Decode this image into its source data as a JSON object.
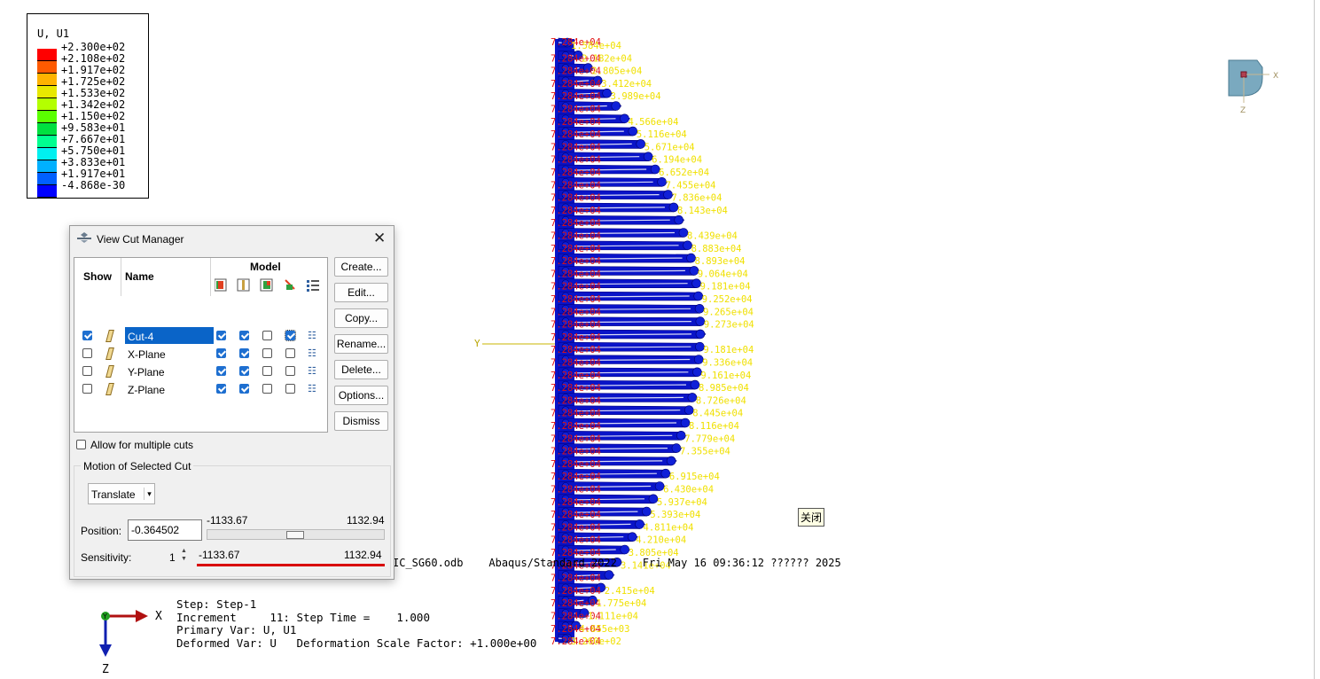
{
  "legend": {
    "title": "U, U1",
    "values": [
      "+2.300e+02",
      "+2.108e+02",
      "+1.917e+02",
      "+1.725e+02",
      "+1.533e+02",
      "+1.342e+02",
      "+1.150e+02",
      "+9.583e+01",
      "+7.667e+01",
      "+5.750e+01",
      "+3.833e+01",
      "+1.917e+01",
      "-4.868e-30"
    ],
    "colors": [
      "#ff0000",
      "#ff5a00",
      "#ffb300",
      "#e8e800",
      "#b4ff00",
      "#5aff00",
      "#00e040",
      "#00ff90",
      "#00f0f0",
      "#00b0ff",
      "#0060ff",
      "#0000ff"
    ]
  },
  "dialog": {
    "title": "View Cut Manager",
    "headers": {
      "show": "Show",
      "name": "Name",
      "model": "Model"
    },
    "rows": [
      {
        "name": "Cut-4",
        "show": true,
        "m1": true,
        "m2": true,
        "m3": false,
        "m4": true
      },
      {
        "name": "X-Plane",
        "show": false,
        "m1": true,
        "m2": true,
        "m3": false,
        "m4": false
      },
      {
        "name": "Y-Plane",
        "show": false,
        "m1": true,
        "m2": true,
        "m3": false,
        "m4": false
      },
      {
        "name": "Z-Plane",
        "show": false,
        "m1": true,
        "m2": true,
        "m3": false,
        "m4": false
      }
    ],
    "buttons": [
      "Create...",
      "Edit...",
      "Copy...",
      "Rename...",
      "Delete...",
      "Options...",
      "Dismiss"
    ],
    "allow_multiple": "Allow for multiple cuts",
    "motion_group": "Motion of Selected Cut",
    "motion_select": "Translate",
    "position_label": "Position:",
    "position_value": "-0.364502",
    "pos_min": "-1133.67",
    "pos_max": "1132.94",
    "sensitivity_label": "Sensitivity:",
    "sensitivity_value": "1",
    "sens_min": "-1133.67",
    "sens_max": "1132.94"
  },
  "info_line": "IC_SG60.odb    Abaqus/Standard 2022    Fri May 16 09:36:12 ?????? 2025",
  "status": {
    "step": "Step: Step-1",
    "increment": "Increment     11: Step Time =    1.000",
    "primary": "Primary Var: U, U1",
    "deformed": "Deformed Var: U   Deformation Scale Factor: +1.000e+00"
  },
  "triad": {
    "x": "X",
    "y": "Y",
    "z": "Z"
  },
  "small_triad": {
    "x": "X",
    "z": "Z"
  },
  "cut_axis_label": "Y",
  "close_tip": "关闭",
  "red_label": "7.284e+04",
  "yellow_labels": [
    "1.584e+04",
    "2.182e+04",
    "2.805e+04",
    "3.412e+04",
    "3.989e+04",
    "4.566e+04",
    "5.116e+04",
    "5.671e+04",
    "6.194e+04",
    "6.652e+04",
    "7.455e+04",
    "7.836e+04",
    "8.143e+04",
    "8.439e+04",
    "8.883e+04",
    "8.893e+04",
    "9.064e+04",
    "9.181e+04",
    "9.252e+04",
    "9.265e+04",
    "9.273e+04",
    "9.181e+04",
    "9.336e+04",
    "9.161e+04",
    "8.985e+04",
    "8.726e+04",
    "8.445e+04",
    "8.116e+04",
    "7.779e+04",
    "7.355e+04",
    "6.915e+04",
    "6.430e+04",
    "5.937e+04",
    "5.393e+04",
    "4.811e+04",
    "4.210e+04",
    "3.805e+04",
    "3.141e+04",
    "2.415e+04",
    "1.775e+04",
    "1.111e+04",
    "4.655e+03",
    "3.260e+02"
  ]
}
